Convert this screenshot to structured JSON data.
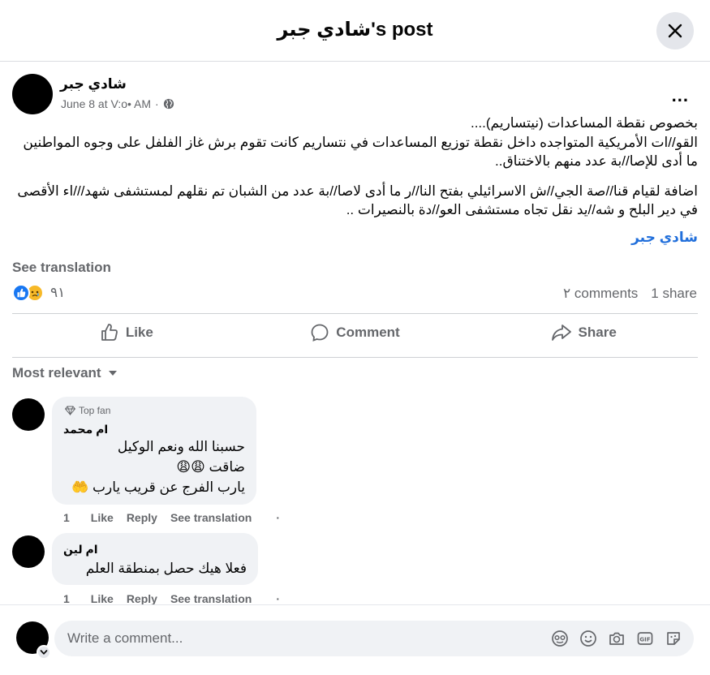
{
  "header": {
    "title": "شادي جبر's post"
  },
  "post": {
    "author": "شادي جبر",
    "date": "June 8 at V:o• AM",
    "privacy_separator": "·",
    "more_label": "...",
    "body": [
      "بخصوص نقطة المساعدات (نيتساريم)....",
      "القو//ات الأمريكية المتواجده داخل نقطة توزيع المساعدات في نتساريم كانت تقوم برش غاز الفلفل على وجوه المواطنين ما أدى للإصا//بة عدد منهم بالاختناق..",
      "اضافة لقيام قنا//صة الجي//ش الاسرائيلي بفتح النا//ر ما أدى لاصا//بة عدد من الشبان تم نقلهم لمستشفى شهد///اء الأقصى في دير البلح و شه//يد نقل تجاه مستشفى العو//دة بالنصيرات .."
    ],
    "hashtag": "شادي جبر",
    "see_translation": "See translation",
    "reaction_count": "٩١",
    "comments_count": "٢ comments",
    "shares_count": "1 share",
    "actions": {
      "like": "Like",
      "comment": "Comment",
      "share": "Share"
    }
  },
  "sort_label": "Most relevant",
  "comments": [
    {
      "badge": "Top fan",
      "author": "ام محمد",
      "lines": [
        "حسبنا الله ونعم الوكيل",
        "ضاقت 😩😩",
        "يارب الفرج عن قريب يارب 🤲"
      ],
      "reaction_count": "1",
      "like": "Like",
      "reply": "Reply",
      "see_translation": "See translation",
      "dot": "·"
    },
    {
      "author": "ام لين",
      "lines": [
        "فعلا هيك حصل بمنطقة العلم"
      ],
      "reaction_count": "1",
      "like": "Like",
      "reply": "Reply",
      "see_translation": "See translation",
      "dot": "·"
    }
  ],
  "composer": {
    "placeholder": "Write a comment..."
  },
  "icons": {
    "close": "close-icon",
    "globe": "globe-icon",
    "like": "thumbs-up-icon",
    "comment": "speech-bubble-icon",
    "share": "share-arrow-icon",
    "sad": "sad-face-icon",
    "avatar_sticker": "avatar-sticker-icon",
    "emoji": "emoji-icon",
    "camera": "camera-icon",
    "gif": "gif-icon",
    "sticker": "sticker-icon"
  },
  "colors": {
    "link": "#216fdb",
    "like_blue": "#1877f2",
    "muted": "#65676b",
    "bubble": "#f0f2f5"
  }
}
